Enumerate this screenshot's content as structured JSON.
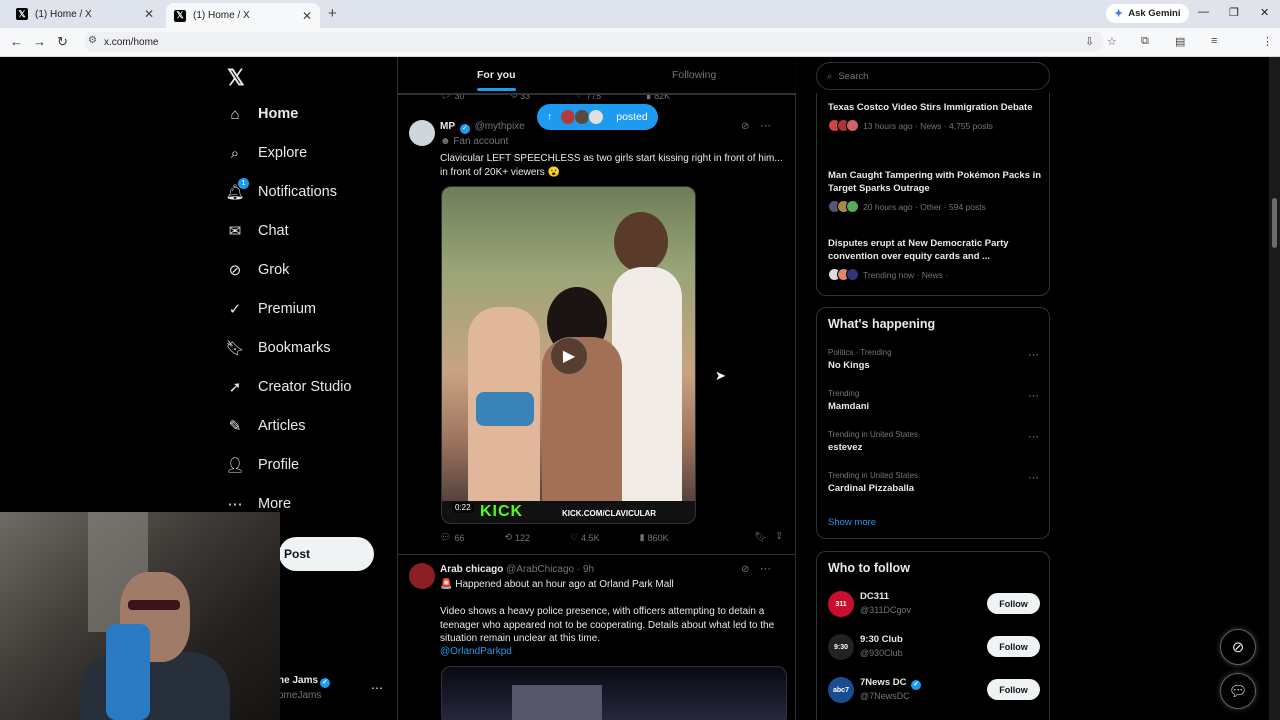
{
  "browser": {
    "tabs": [
      {
        "label": "(1) Home / X",
        "active": false
      },
      {
        "label": "(1) Home / X",
        "active": true
      }
    ],
    "url": "x.com/home",
    "gemini_label": "Ask Gemini"
  },
  "nav": {
    "items": [
      {
        "label": "Home",
        "icon": "home-icon"
      },
      {
        "label": "Explore",
        "icon": "search-icon"
      },
      {
        "label": "Notifications",
        "icon": "bell-icon",
        "badge": "1"
      },
      {
        "label": "Chat",
        "icon": "mail-icon"
      },
      {
        "label": "Grok",
        "icon": "grok-icon"
      },
      {
        "label": "Premium",
        "icon": "verified-icon"
      },
      {
        "label": "Bookmarks",
        "icon": "bookmark-icon"
      },
      {
        "label": "Creator Studio",
        "icon": "rocket-icon"
      },
      {
        "label": "Articles",
        "icon": "article-icon"
      },
      {
        "label": "Profile",
        "icon": "profile-icon"
      },
      {
        "label": "More",
        "icon": "more-circle-icon"
      }
    ],
    "post_label": "Post",
    "account": {
      "name": "ne Jams",
      "handle": "omeJams"
    }
  },
  "feed": {
    "tabs": {
      "for_you": "For you",
      "following": "Following"
    },
    "prev_actions": {
      "replies": "30",
      "reposts": "33",
      "likes": "775",
      "views": "82K"
    },
    "posted_pill": "posted",
    "tweet1": {
      "name": "MP",
      "handle": "@mythpixe",
      "sub": "Fan account",
      "text": "Clavicular LEFT SPEECHLESS as two girls start kissing right in front of him... in front of 20K+ viewers 😮",
      "video_duration": "0:22",
      "kick_logo": "KICK",
      "kick_url": "KICK.COM/CLAVICULAR",
      "replies": "66",
      "reposts": "122",
      "likes": "4.5K",
      "views": "860K"
    },
    "tweet2": {
      "name": "Arab chicago",
      "handle": "@ArabChicago",
      "time": "· 9h",
      "line1": "🚨 Happened about an hour ago at Orland Park Mall",
      "line2": "Video shows a heavy police presence, with officers attempting to detain a teenager who appeared not to be cooperating. Details about what led to the situation remain unclear at this time.",
      "mention": "@OrlandParkpd"
    }
  },
  "sidebar": {
    "search_placeholder": "Search",
    "news": [
      {
        "title": "Texas Costco Video Stirs Immigration Debate",
        "meta": "13 hours ago · News · 4,755 posts"
      },
      {
        "title": "Man Caught Tampering with Pokémon Packs in Target Sparks Outrage",
        "meta": "20 hours ago · Other · 594 posts"
      },
      {
        "title": "Disputes erupt at New Democratic Party convention over equity cards and ...",
        "meta": "Trending now · News ·"
      }
    ],
    "whats_happening": {
      "title": "What's happening",
      "trends": [
        {
          "context": "Politics · Trending",
          "name": "No Kings"
        },
        {
          "context": "Trending",
          "name": "Mamdani"
        },
        {
          "context": "Trending in United States",
          "name": "estevez"
        },
        {
          "context": "Trending in United States",
          "name": "Cardinal Pizzaballa"
        }
      ],
      "show_more": "Show more"
    },
    "who_to_follow": {
      "title": "Who to follow",
      "accounts": [
        {
          "name": "DC311",
          "handle": "@311DCgov",
          "avatar_text": "311",
          "avatar_color": "#c8102e",
          "verified": false
        },
        {
          "name": "9:30 Club",
          "handle": "@930Club",
          "avatar_text": "9:30",
          "avatar_color": "#222222",
          "verified": false
        },
        {
          "name": "7News DC",
          "handle": "@7NewsDC",
          "avatar_text": "abc7",
          "avatar_color": "#1a4d8f",
          "verified": true
        }
      ],
      "follow_label": "Follow"
    }
  },
  "colors": {
    "accent": "#1d9bf0",
    "background": "#000000",
    "border": "#2f3336",
    "muted": "#71767b"
  }
}
